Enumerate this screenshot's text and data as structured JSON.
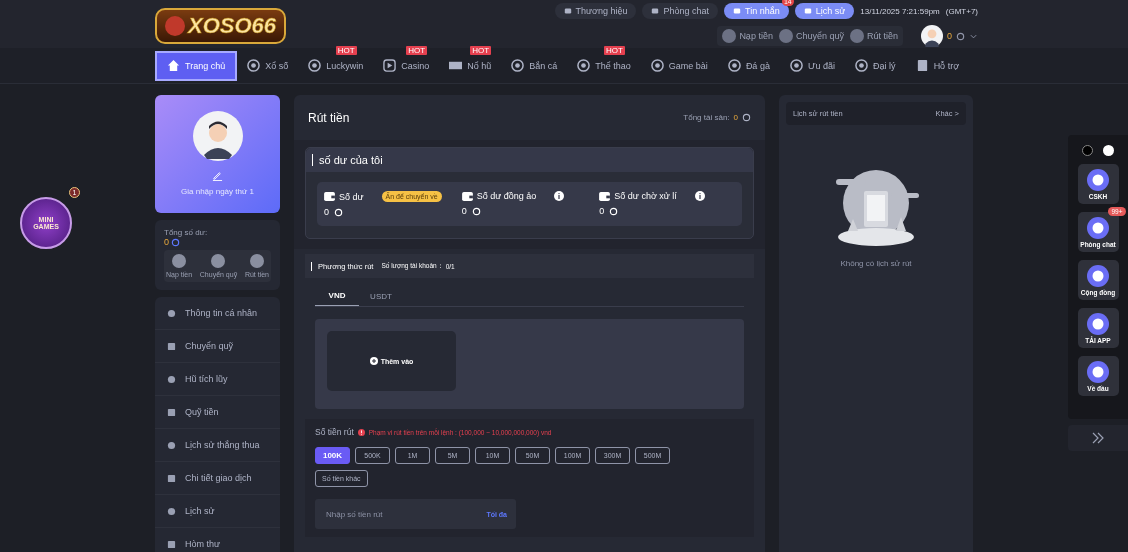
{
  "header": {
    "logo_text": "XOSO66",
    "top_links": [
      {
        "label": "Thương hiệu",
        "kind": "plain"
      },
      {
        "label": "Phòng chat",
        "kind": "plain"
      },
      {
        "label": "Tin nhắn",
        "kind": "accent",
        "badge": "14"
      },
      {
        "label": "Lịch sử",
        "kind": "accent"
      }
    ],
    "datetime": "13/11/2025 7:21:59pm",
    "timezone": "(GMT+7)",
    "wallet_actions": [
      "Nạp tiền",
      "Chuyển quỹ",
      "Rút tiền"
    ],
    "balance": "0"
  },
  "nav": [
    {
      "label": "Trang chủ",
      "selected": true
    },
    {
      "label": "Xổ số",
      "selected": false
    },
    {
      "label": "Luckywin",
      "selected": false,
      "badge": "HOT"
    },
    {
      "label": "Casino",
      "selected": false,
      "badge": "HOT"
    },
    {
      "label": "Nổ hũ",
      "selected": false,
      "badge": "HOT"
    },
    {
      "label": "Bắn cá",
      "selected": false
    },
    {
      "label": "Thể thao",
      "selected": false,
      "badge": "HOT"
    },
    {
      "label": "Game bài",
      "selected": false
    },
    {
      "label": "Đá gà",
      "selected": false
    },
    {
      "label": "Ưu đãi",
      "selected": false
    },
    {
      "label": "Đại lý",
      "selected": false
    },
    {
      "label": "Hỗ trợ",
      "selected": false
    }
  ],
  "mini_games": {
    "label": "MINI GAMES",
    "badge": "1"
  },
  "profile": {
    "join_text": "Gia nhập ngày thứ 1",
    "total_label": "Tổng số dư:",
    "total_value": "0",
    "actions": [
      "Nạp tiền",
      "Chuyển quỹ",
      "Rút tiền"
    ]
  },
  "menu": [
    "Thông tin cá nhân",
    "Chuyển quỹ",
    "Hũ tích lũy",
    "Quỹ tiền",
    "Lịch sử thắng thua",
    "Chi tiết giao dịch",
    "Lịch sử",
    "Hòm thư"
  ],
  "withdraw": {
    "title": "Rút tiền",
    "assets_label": "Tổng tài sản:",
    "assets_value": "0",
    "balance_title": "số dư của tôi",
    "balances": [
      {
        "label": "Số dư",
        "value": "0",
        "kind": "action",
        "action": "Ấn để chuyển về"
      },
      {
        "label": "Số dư đồng ảo",
        "value": "0",
        "kind": "info"
      },
      {
        "label": "Số dư chờ xử lí",
        "value": "0",
        "kind": "info"
      }
    ],
    "method_title": "Phương thức rút",
    "account_count_label": "Số lượng tài khoản：",
    "account_count": "0/1",
    "tabs": [
      {
        "label": "VND",
        "selected": true
      },
      {
        "label": "USDT",
        "selected": false
      }
    ],
    "add_label": "Thêm vào",
    "amount_label": "Số tiền rút",
    "range_note": "Phạm vi rút tiền trên mỗi lệnh : (100,000 ~ 10,000,000,000) vnd",
    "amounts": [
      {
        "label": "100K",
        "selected": true
      },
      {
        "label": "500K",
        "selected": false
      },
      {
        "label": "1M",
        "selected": false
      },
      {
        "label": "5M",
        "selected": false
      },
      {
        "label": "10M",
        "selected": false
      },
      {
        "label": "50M",
        "selected": false
      },
      {
        "label": "100M",
        "selected": false
      },
      {
        "label": "300M",
        "selected": false
      },
      {
        "label": "500M",
        "selected": false
      },
      {
        "label": "Số tiền khác",
        "selected": false
      }
    ],
    "input_placeholder": "Nhập số tiền rút",
    "max_label": "Tối đa"
  },
  "history": {
    "title": "Lịch sử rút tiền",
    "more": "Khác >",
    "empty": "Không có lịch sử rút"
  },
  "float_menu": [
    {
      "label": "CSKH"
    },
    {
      "label": "Phòng chat",
      "badge": "99+"
    },
    {
      "label": "Cộng đồng"
    },
    {
      "label": "TẢI APP"
    },
    {
      "label": "Về đầu"
    }
  ]
}
